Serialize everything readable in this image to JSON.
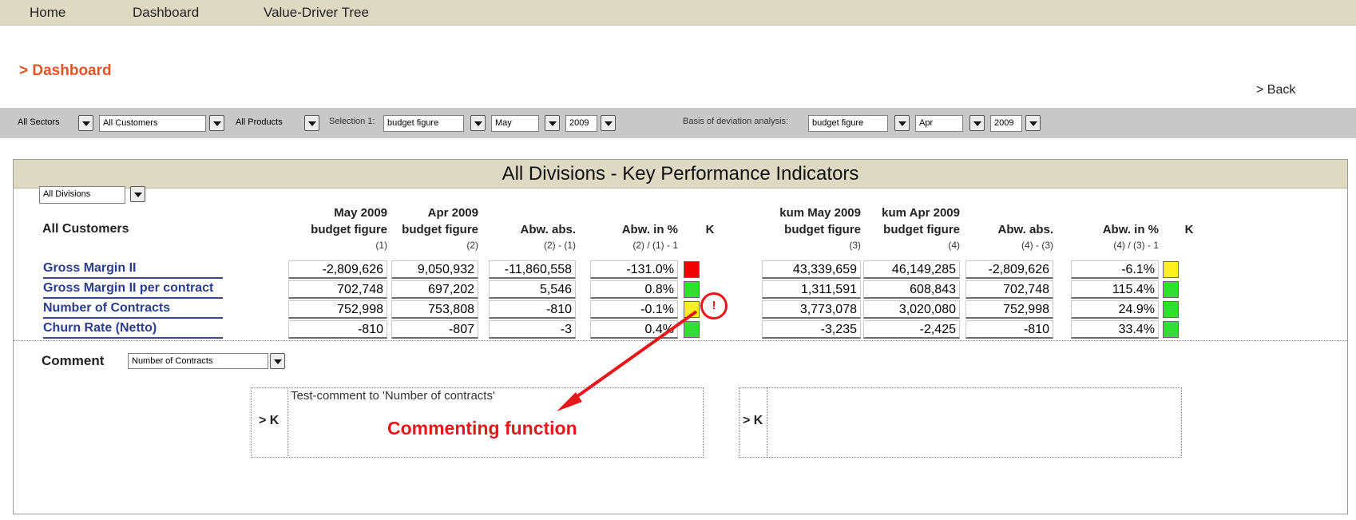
{
  "menu": [
    "Home",
    "Dashboard",
    "Value-Driver Tree"
  ],
  "page_title": "> Dashboard",
  "back_label": "> Back",
  "filters": {
    "sectors": "All Sectors",
    "customers": "All Customers",
    "products": "All Products",
    "selection_label": "Selection 1:",
    "selection_figure": "budget figure",
    "selection_month": "May",
    "selection_year": "2009",
    "basis_label": "Basis of deviation analysis:",
    "basis_figure": "budget figure",
    "basis_month": "Apr",
    "basis_year": "2009"
  },
  "panel": {
    "title": "All Divisions  -  Key Performance Indicators",
    "division_select": "All Divisions",
    "customer_heading": "All Customers",
    "columns": [
      {
        "line1": "May 2009",
        "line2": "budget figure",
        "sub": "(1)"
      },
      {
        "line1": "Apr 2009",
        "line2": "budget figure",
        "sub": "(2)"
      },
      {
        "line1": "",
        "line2": "Abw. abs.",
        "sub": "(2) - (1)"
      },
      {
        "line1": "",
        "line2": "Abw. in %",
        "sub": "(2) / (1) - 1"
      },
      {
        "line1": "",
        "line2": "K",
        "sub": ""
      },
      {
        "line1": "kum May 2009",
        "line2": "budget figure",
        "sub": "(3)"
      },
      {
        "line1": "kum Apr 2009",
        "line2": "budget figure",
        "sub": "(4)"
      },
      {
        "line1": "",
        "line2": "Abw. abs.",
        "sub": "(4) - (3)"
      },
      {
        "line1": "",
        "line2": "Abw. in %",
        "sub": "(4) / (3) - 1"
      },
      {
        "line1": "",
        "line2": "K",
        "sub": ""
      }
    ],
    "rows": [
      {
        "label": "Gross Margin II",
        "v1": "-2,809,626",
        "v2": "9,050,932",
        "abs1": "-11,860,558",
        "pct1": "-131.0%",
        "k1": "red",
        "v3": "43,339,659",
        "v4": "46,149,285",
        "abs2": "-2,809,626",
        "pct2": "-6.1%",
        "k2": "yellow"
      },
      {
        "label": "Gross Margin II per contract",
        "v1": "702,748",
        "v2": "697,202",
        "abs1": "5,546",
        "pct1": "0.8%",
        "k1": "green",
        "v3": "1,311,591",
        "v4": "608,843",
        "abs2": "702,748",
        "pct2": "115.4%",
        "k2": "green"
      },
      {
        "label": "Number of Contracts",
        "v1": "752,998",
        "v2": "753,808",
        "abs1": "-810",
        "pct1": "-0.1%",
        "k1": "yellow",
        "v3": "3,773,078",
        "v4": "3,020,080",
        "abs2": "752,998",
        "pct2": "24.9%",
        "k2": "green"
      },
      {
        "label": "Churn Rate (Netto)",
        "v1": "-810",
        "v2": "-807",
        "abs1": "-3",
        "pct1": "0.4%",
        "k1": "green",
        "v3": "-3,235",
        "v4": "-2,425",
        "abs2": "-810",
        "pct2": "33.4%",
        "k2": "green"
      }
    ],
    "comment_marker": "!",
    "comment_label": "Comment",
    "comment_select": "Number of Contracts",
    "k_link_left": "> K",
    "k_link_right": "> K",
    "comment_left_text": "Test-comment to 'Number of contracts'",
    "comment_right_text": "",
    "annotation": "Commenting function"
  },
  "colors": {
    "menu_bg": "#ddd9c3",
    "title_orange": "#e0552b",
    "row_label_blue": "#2b3d8f",
    "flag_red": "#ee0000",
    "flag_green": "#33dd33",
    "flag_yellow": "#ffee22",
    "annotation_red": "#e8151b"
  }
}
